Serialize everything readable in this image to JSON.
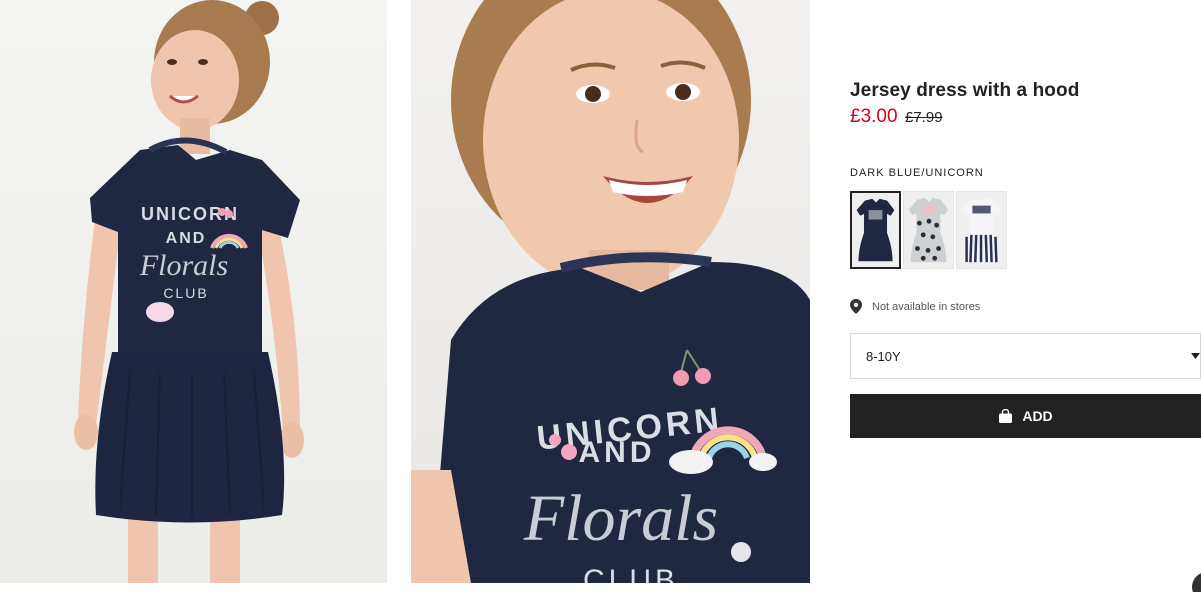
{
  "product": {
    "title": "Jersey dress with a hood",
    "price_sale": "£3.00",
    "price_old": "£7.99"
  },
  "color": {
    "selected_name": "DARK BLUE/UNICORN",
    "swatches": [
      {
        "label": "dark blue unicorn",
        "color": "#1f2741"
      },
      {
        "label": "grey spotted",
        "color": "#cfd0d2"
      },
      {
        "label": "white striped",
        "color": "#e8e8ea"
      }
    ]
  },
  "store": {
    "availability": "Not available in stores"
  },
  "size": {
    "selected": "8-10Y"
  },
  "cart": {
    "add_label": "ADD"
  },
  "images": {
    "print_line1": "UNICORN",
    "print_line2": "AND",
    "print_line3": "Florals",
    "print_line4": "CLUB",
    "zoom_line4": "CLUB"
  },
  "colors": {
    "sale": "#d6001c",
    "dress": "#1f2741",
    "button": "#222222"
  }
}
